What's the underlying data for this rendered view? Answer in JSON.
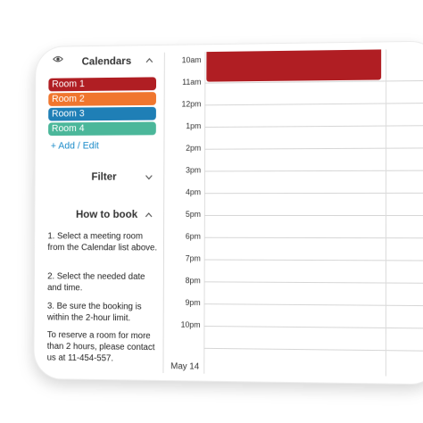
{
  "sidebar": {
    "calendars_title": "Calendars",
    "rooms": [
      {
        "label": "Room 1",
        "color": "#b01e23"
      },
      {
        "label": "Room 2",
        "color": "#f0762e"
      },
      {
        "label": "Room 3",
        "color": "#1f7fb6"
      },
      {
        "label": "Room 4",
        "color": "#4bb79a"
      }
    ],
    "add_edit": "+ Add / Edit",
    "filter_title": "Filter",
    "how_to_book_title": "How to book",
    "instructions": [
      "1. Select a meeting room from the Calendar list above.",
      "2. Select the needed date and time.",
      "3. Be sure the booking is within the 2-hour limit.",
      "To reserve a room for more than 2 hours, please contact us at  11-454-557."
    ]
  },
  "calendar": {
    "times": [
      "10am",
      "11am",
      "12pm",
      "1pm",
      "2pm",
      "3pm",
      "4pm",
      "5pm",
      "6pm",
      "7pm",
      "8pm",
      "9pm",
      "10pm"
    ],
    "date_label": "May 14",
    "event_color": "#b01e23"
  },
  "colors": {
    "accent": "#1a8bc9",
    "grid": "#d6d6d6"
  }
}
